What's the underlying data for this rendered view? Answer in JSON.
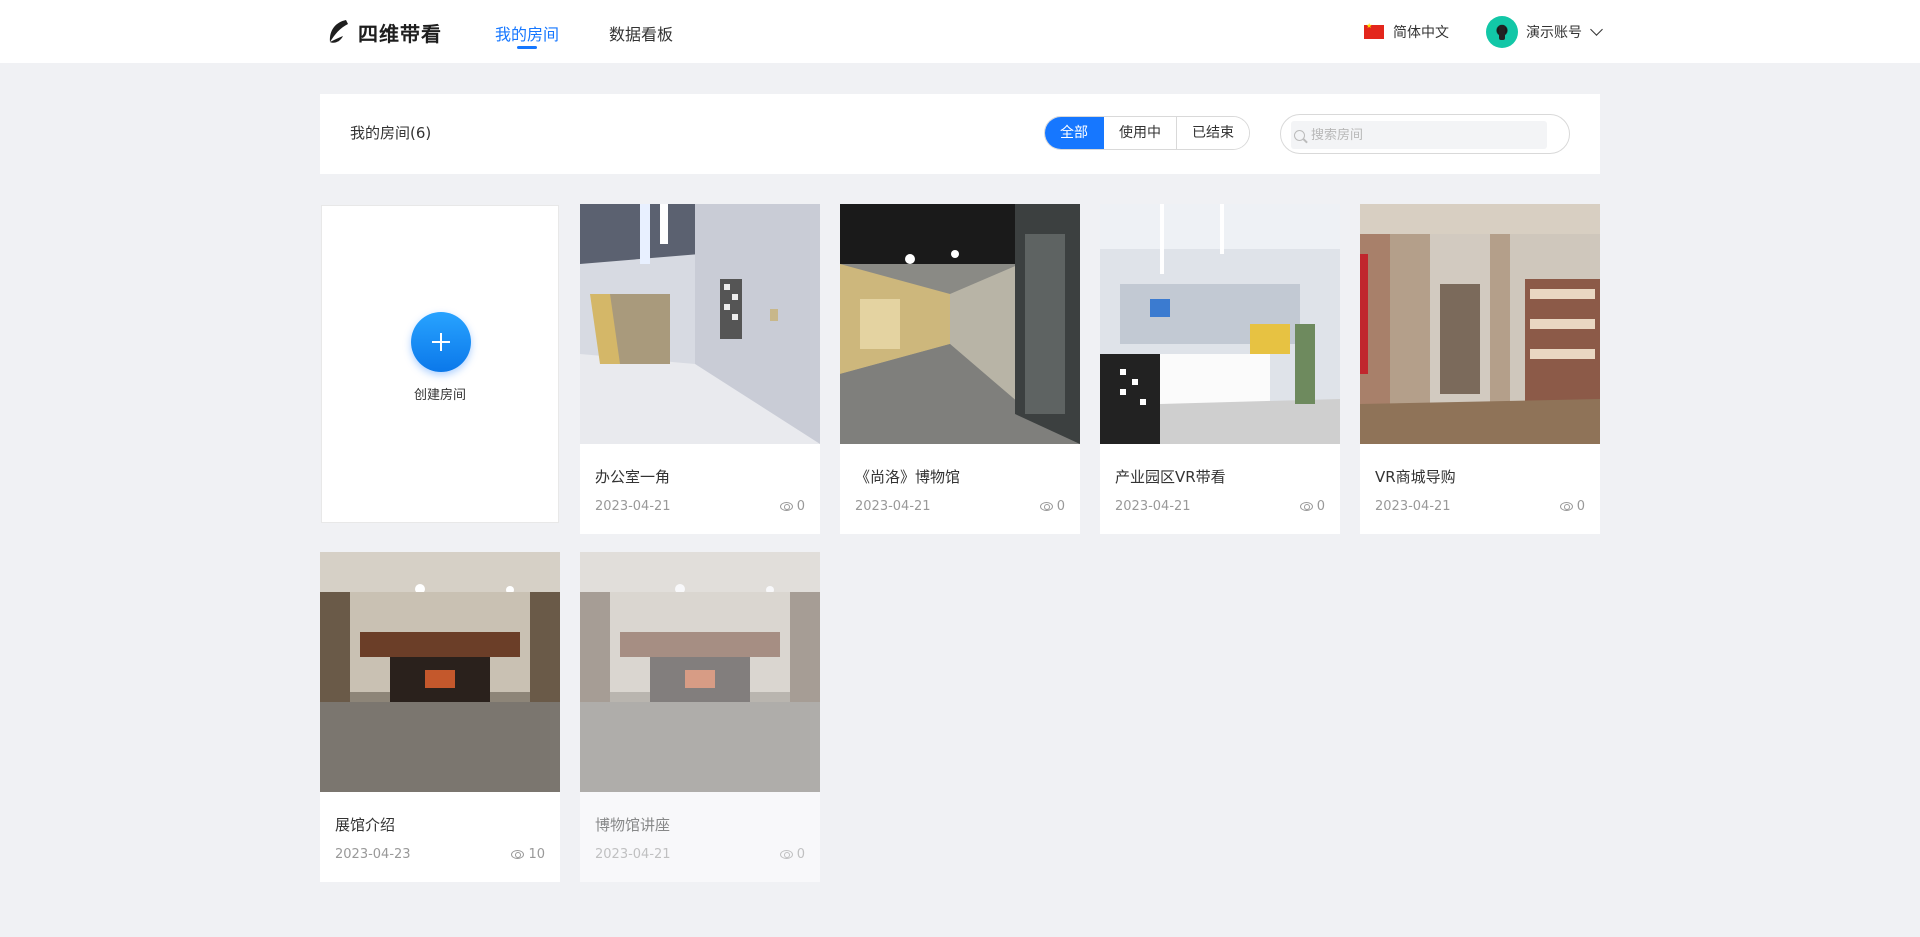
{
  "app": {
    "logo_text": "四维带看"
  },
  "nav": {
    "tabs": [
      {
        "label": "我的房间",
        "active": true
      },
      {
        "label": "数据看板",
        "active": false
      }
    ]
  },
  "header_right": {
    "language": "简体中文",
    "account": "演示账号"
  },
  "panel": {
    "title": "我的房间(6)",
    "filters": [
      {
        "label": "全部",
        "active": true
      },
      {
        "label": "使用中",
        "active": false
      },
      {
        "label": "已结束",
        "active": false
      }
    ],
    "search_placeholder": "搜索房间"
  },
  "create": {
    "label": "创建房间"
  },
  "rooms": [
    {
      "title": "办公室一角",
      "date": "2023-04-21",
      "views": "0",
      "ended": false
    },
    {
      "title": "《尚洛》博物馆",
      "date": "2023-04-21",
      "views": "0",
      "ended": false
    },
    {
      "title": "产业园区VR带看",
      "date": "2023-04-21",
      "views": "0",
      "ended": false
    },
    {
      "title": "VR商城导购",
      "date": "2023-04-21",
      "views": "0",
      "ended": false
    },
    {
      "title": "展馆介绍",
      "date": "2023-04-23",
      "views": "10",
      "ended": false
    },
    {
      "title": "博物馆讲座",
      "date": "2023-04-21",
      "views": "0",
      "ended": true
    }
  ],
  "colors": {
    "accent": "#1677ff",
    "background": "#f0f1f4"
  }
}
